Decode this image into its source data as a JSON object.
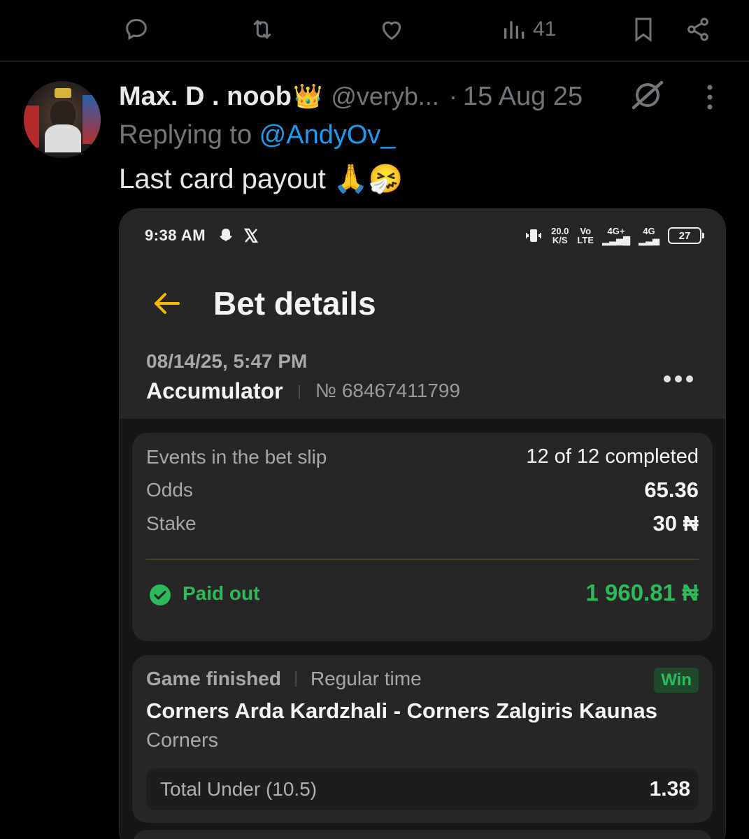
{
  "actions": {
    "reply_icon": "reply-icon",
    "repost_icon": "repost-icon",
    "like_icon": "heart-icon",
    "views_icon": "views-icon",
    "views_count": "41",
    "bookmark_icon": "bookmark-icon",
    "share_icon": "share-icon"
  },
  "tweet": {
    "display_name": "Max. D . noob",
    "crown": "👑",
    "handle": "@veryb...",
    "dot": "·",
    "date": "15 Aug 25",
    "replying_prefix": "Replying to ",
    "replying_to": "@AndyOv_",
    "text": "Last card payout 🙏🤧"
  },
  "screenshot": {
    "status_bar": {
      "time": "9:38 AM",
      "speed": "20.0",
      "speed_unit": "K/S",
      "volte_top": "Vo",
      "volte_bottom": "LTE",
      "net1": "4G+",
      "net2": "4G",
      "battery": "27"
    },
    "title": "Bet details",
    "bet_date": "08/14/25, 5:47 PM",
    "bet_type": "Accumulator",
    "bet_number": "№ 68467411799",
    "summary": {
      "events_label": "Events in the bet slip",
      "events_value": "12 of 12 completed",
      "odds_label": "Odds",
      "odds_value": "65.36",
      "stake_label": "Stake",
      "stake_value": "30 ₦",
      "paid_label": "Paid out",
      "paid_amount": "1 960.81 ₦"
    },
    "event": {
      "status": "Game finished",
      "period": "Regular time",
      "result": "Win",
      "match": "Corners Arda Kardzhali - Corners Zalgiris Kaunas",
      "market": "Corners",
      "pick_label": "Total Under (10.5)",
      "pick_odds": "1.38"
    }
  },
  "colors": {
    "background": "#000000",
    "muted": "#71767b",
    "link": "#1d9bf0",
    "accent_yellow": "#f5b800",
    "success": "#2dbb5a"
  }
}
